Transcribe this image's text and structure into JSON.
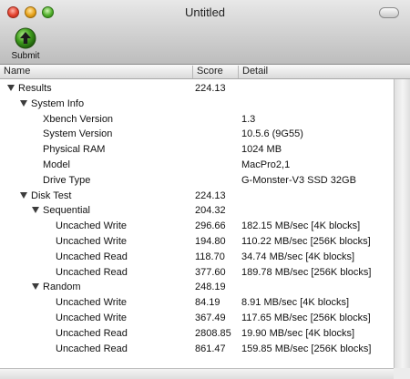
{
  "window": {
    "title": "Untitled"
  },
  "toolbar": {
    "submit_label": "Submit"
  },
  "columns": {
    "name": "Name",
    "score": "Score",
    "detail": "Detail"
  },
  "rows": [
    {
      "name": "Results",
      "score": "224.13",
      "detail": ""
    },
    {
      "name": "System Info",
      "score": "",
      "detail": ""
    },
    {
      "name": "Xbench Version",
      "score": "",
      "detail": "1.3"
    },
    {
      "name": "System Version",
      "score": "",
      "detail": "10.5.6 (9G55)"
    },
    {
      "name": "Physical RAM",
      "score": "",
      "detail": "1024 MB"
    },
    {
      "name": "Model",
      "score": "",
      "detail": "MacPro2,1"
    },
    {
      "name": "Drive Type",
      "score": "",
      "detail": "G-Monster-V3 SSD 32GB"
    },
    {
      "name": "Disk Test",
      "score": "224.13",
      "detail": ""
    },
    {
      "name": "Sequential",
      "score": "204.32",
      "detail": ""
    },
    {
      "name": "Uncached Write",
      "score": "296.66",
      "detail": "182.15 MB/sec [4K blocks]"
    },
    {
      "name": "Uncached Write",
      "score": "194.80",
      "detail": "110.22 MB/sec [256K blocks]"
    },
    {
      "name": "Uncached Read",
      "score": "118.70",
      "detail": "34.74 MB/sec [4K blocks]"
    },
    {
      "name": "Uncached Read",
      "score": "377.60",
      "detail": "189.78 MB/sec [256K blocks]"
    },
    {
      "name": "Random",
      "score": "248.19",
      "detail": ""
    },
    {
      "name": "Uncached Write",
      "score": "84.19",
      "detail": "8.91 MB/sec [4K blocks]"
    },
    {
      "name": "Uncached Write",
      "score": "367.49",
      "detail": "117.65 MB/sec [256K blocks]"
    },
    {
      "name": "Uncached Read",
      "score": "2808.85",
      "detail": "19.90 MB/sec [4K blocks]"
    },
    {
      "name": "Uncached Read",
      "score": "861.47",
      "detail": "159.85 MB/sec [256K blocks]"
    }
  ]
}
